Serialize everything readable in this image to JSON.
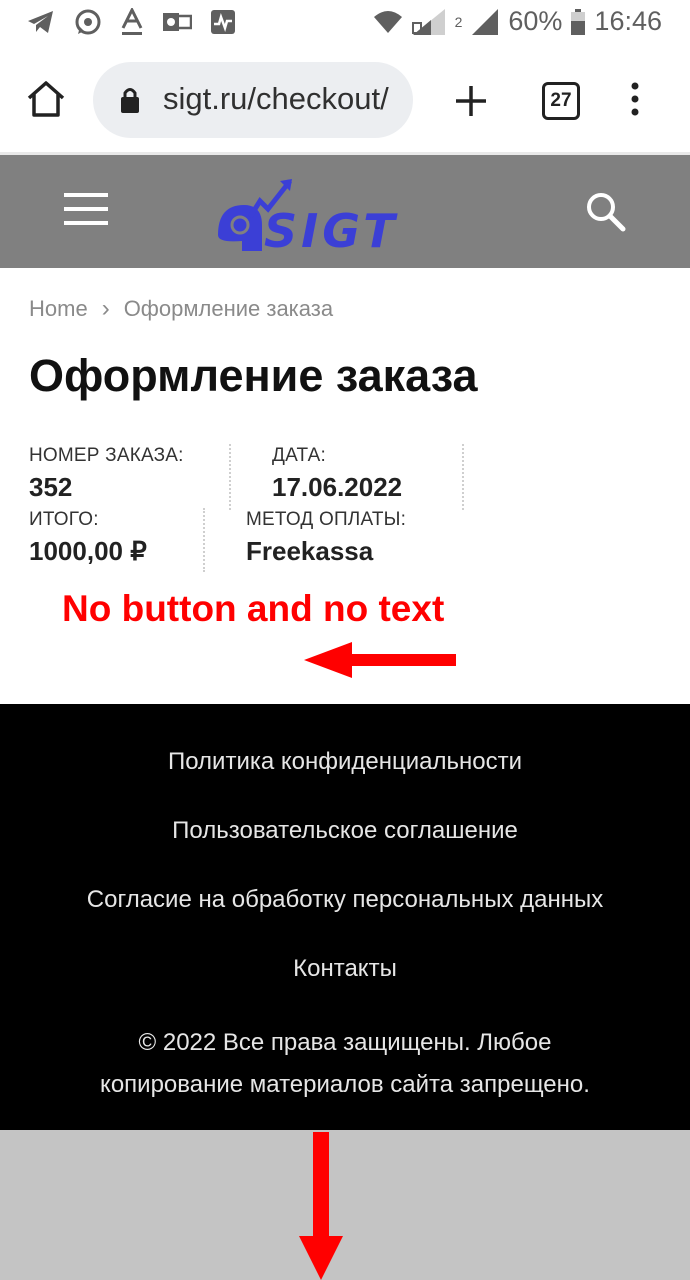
{
  "status_bar": {
    "battery": "60%",
    "time": "16:46",
    "sim_2_label": "2"
  },
  "browser": {
    "url": "sigt.ru/checkout/",
    "tab_count": "27"
  },
  "site_header": {
    "logo_text": "SIGT"
  },
  "breadcrumb": {
    "home": "Home",
    "separator": "›",
    "current": "Оформление заказа"
  },
  "page": {
    "title": "Оформление заказа"
  },
  "order": {
    "number_label": "НОМЕР ЗАКАЗА:",
    "number": "352",
    "date_label": "ДАТА:",
    "date": "17.06.2022",
    "total_label": "ИТОГО:",
    "total": "1000,00 ₽",
    "payment_label": "МЕТОД ОПЛАТЫ:",
    "payment": "Freekassa"
  },
  "annotation": {
    "text": "No button and no text",
    "color": "#ff0000"
  },
  "footer": {
    "links": [
      "Политика конфиденциальности",
      "Пользовательское соглашение",
      "Согласие на обработку персональных данных",
      "Контакты"
    ],
    "copyright_line1": "© 2022 Все права защищены. Любое",
    "copyright_line2": "копирование материалов сайта запрещено."
  },
  "colors": {
    "header_bg": "#808080",
    "logo_blue": "#3b3fd6",
    "footer_bg": "#000000",
    "bottom_area": "#c4c4c4"
  }
}
